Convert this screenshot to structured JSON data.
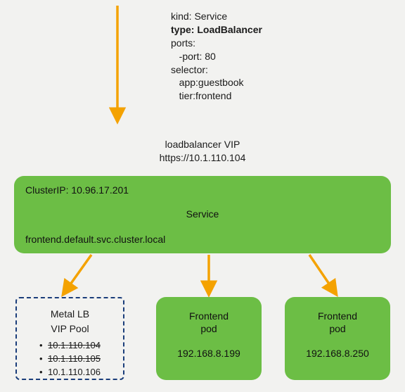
{
  "yaml": {
    "l1": "kind: Service",
    "l2": "type: LoadBalancer",
    "l3": "ports:",
    "l4": "   -port: 80",
    "l5": "selector:",
    "l6": "   app:guestbook",
    "l7": "   tier:frontend"
  },
  "vip": {
    "label": "loadbalancer VIP",
    "url": "https://10.1.110.104"
  },
  "service": {
    "cluster_ip_label": "ClusterIP: 10.96.17.201",
    "title": "Service",
    "dns": "frontend.default.svc.cluster.local"
  },
  "metal": {
    "title": "Metal LB",
    "subtitle": "VIP Pool",
    "ips": [
      "10.1.110.104",
      "10.1.110.105",
      "10.1.110.106"
    ],
    "used": [
      true,
      true,
      false
    ]
  },
  "pods": [
    {
      "name": "Frontend\npod",
      "ip": "192.168.8.199"
    },
    {
      "name": "Frontend\npod",
      "ip": "192.168.8.250"
    }
  ],
  "colors": {
    "green": "#6cbe45",
    "arrow": "#f4a200",
    "dash": "#1a3d7a"
  }
}
